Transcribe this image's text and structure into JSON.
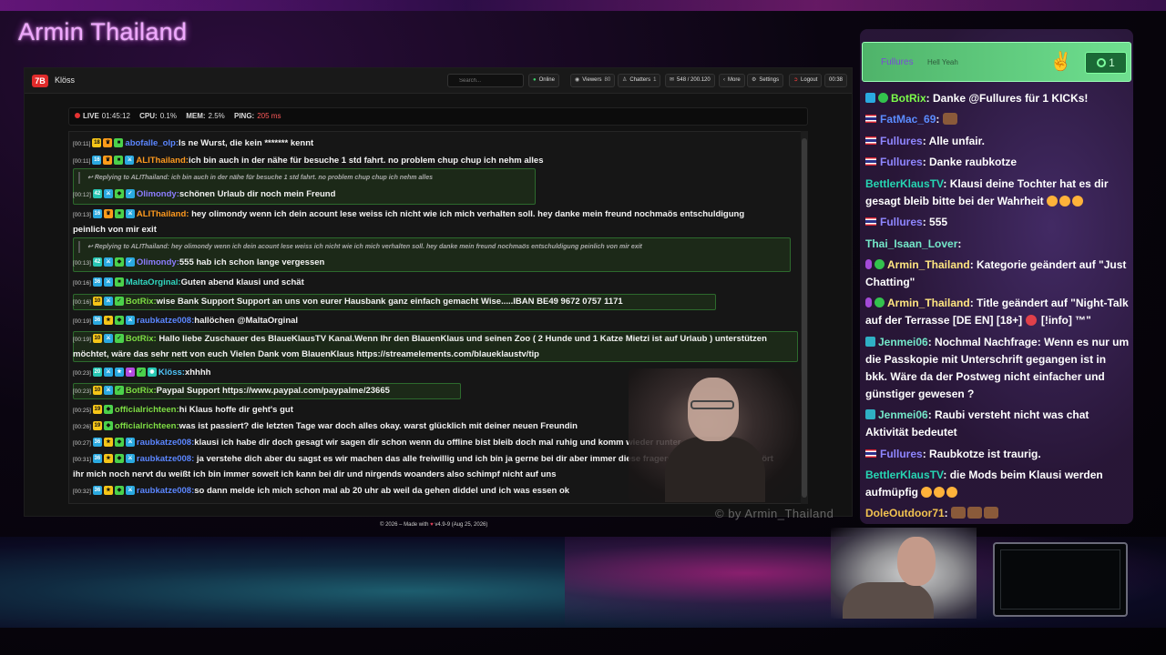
{
  "overlay": {
    "streamer_title": "Armin Thailand",
    "watermark": "© by Armin_Thailand"
  },
  "app": {
    "logo": "7B",
    "name": "Klöss",
    "search_placeholder": "Search...",
    "toolbar": {
      "online": "Online",
      "viewers_label": "Viewers",
      "viewers_count": "80",
      "chatters_label": "Chatters",
      "chatters_count": "1",
      "messages": "548 / 200.120",
      "more": "More",
      "settings": "Settings",
      "logout": "Logout",
      "timer": "00:38"
    },
    "status": {
      "live_label": "LIVE",
      "live_time": "01:45:12",
      "cpu_label": "CPU:",
      "cpu_value": "0.1%",
      "mem_label": "MEM:",
      "mem_value": "2.5%",
      "ping_label": "PING:",
      "ping_value": "205 ms"
    },
    "footer": {
      "left": "© 2026 – Made with",
      "right": "v4.9-9 (Aug 25, 2026)"
    }
  },
  "chat": [
    {
      "ts": "[00:11]",
      "badges": [
        "18"
      ],
      "user": "abofalle_olp:",
      "text": "Is ne Wurst, die kein ******* kennt"
    },
    {
      "ts": "[00:11]",
      "badges": [
        "16"
      ],
      "user": "ALIThailand:",
      "text": "ich bin auch in der nähe für besuche 1 std fahrt. no problem chup chup ich nehm alles"
    },
    {
      "reply": "Replying to ALIThailand: ich bin auch in der nähe für besuche 1 std fahrt. no problem chup chup ich nehm alles"
    },
    {
      "ts": "[00:12]",
      "badges": [
        "42"
      ],
      "user": "Olimondy:",
      "text": "schönen Urlaub dir noch mein Freund"
    },
    {
      "ts": "[00:13]",
      "badges": [
        "16"
      ],
      "user": "ALIThailand:",
      "text": "hey olimondy wenn ich dein acount lese weiss ich nicht wie ich mich verhalten soll. hey danke mein freund nochmaös entschuldigung peinlich von mir exit"
    },
    {
      "reply": "Replying to ALIThailand: hey olimondy wenn ich dein acount lese weiss ich nicht wie ich mich verhalten soll. hey danke mein freund nochmaös entschuldigung peinlich von mir exit"
    },
    {
      "ts": "[00:13]",
      "badges": [
        "42"
      ],
      "user": "Olimondy:",
      "text": "555 hab ich schon lange vergessen"
    },
    {
      "ts": "[00:16]",
      "badges": [
        "36"
      ],
      "user": "MaltaOrginal:",
      "text": "Guten abend klausi und schät"
    },
    {
      "ts": "[00:16]",
      "badges": [
        "10"
      ],
      "user": "BotRix:",
      "text": "wise Bank Support Support an uns von eurer Hausbank ganz einfach gemacht Wise.....IBAN BE49 9672 0757 1171"
    },
    {
      "ts": "[00:19]",
      "badges": [
        "36"
      ],
      "user": "raubkatze008:",
      "text": "hallöchen @MaltaOrginal"
    },
    {
      "ts": "[00:19]",
      "badges": [
        "10"
      ],
      "user": "BotRix:",
      "text": "Hallo liebe Zuschauer des BlaueKlausTV Kanal.Wenn Ihr den BlauenKlaus und seinen Zoo ( 2 Hunde und 1 Katze Mietzi ist auf Urlaub ) unterstützen möchtet, wäre das sehr nett von euch Vielen Dank vom BlauenKlaus https://streamelements.com/blaueklaustv/tip"
    },
    {
      "ts": "[00:23]",
      "badges": [
        "20"
      ],
      "user": "Klöss:",
      "text": "xhhhh"
    },
    {
      "ts": "[00:23]",
      "badges": [
        "10"
      ],
      "user": "BotRix:",
      "text": "Paypal Support https://www.paypal.com/paypalme/23665"
    },
    {
      "ts": "[00:25]",
      "badges": [
        "19"
      ],
      "user": "officialrichteen:",
      "text": "hi Klaus hoffe dir geht's gut"
    },
    {
      "ts": "[00:26]",
      "badges": [
        "19"
      ],
      "user": "officialrichteen:",
      "text": "was ist passiert? die letzten Tage war doch alles okay. warst glücklich mit deiner neuen Freundin"
    },
    {
      "ts": "[00:27]",
      "badges": [
        "36"
      ],
      "user": "raubkatze008:",
      "text": "klausi ich habe dir doch gesagt wir sagen dir schon wenn du offline bist bleib doch mal ruhig und komm wieder runter"
    },
    {
      "ts": "[00:31]",
      "badges": [
        "36"
      ],
      "user": "raubkatze008:",
      "text": "ja verstehe dich aber du sagst es wir machen das alle freiwillig und ich bin ja gerne bei dir aber immer diese fragerei bin ich online oder hört ihr mich noch nervt du weißt ich bin immer soweit ich kann bei dir und nirgends woanders also schimpf nicht auf uns"
    },
    {
      "ts": "[00:32]",
      "badges": [
        "36"
      ],
      "user": "raubkatze008:",
      "text": "so dann melde ich mich schon mal ab 20 uhr ab weil da gehen diddel und ich was essen ok"
    }
  ],
  "side_chat": {
    "top_user": "Fullures",
    "top_message": "Hell Yeah",
    "top_count": "1",
    "messages": [
      {
        "user": "BotRix",
        "text": ": Danke @Fullures für 1 KICKs!"
      },
      {
        "user": "FatMac_69",
        "text": ":"
      },
      {
        "user": "Fullures",
        "text": ": Alle unfair."
      },
      {
        "user": "Fullures",
        "text": ": Danke raubkotze"
      },
      {
        "user": "BettlerKlausTV",
        "text": ": Klausi deine Tochter hat es dir gesagt bleib bitte bei der Wahrheit"
      },
      {
        "user": "Fullures",
        "text": ": 555"
      },
      {
        "user": "Thai_Isaan_Lover",
        "text": ":"
      },
      {
        "user": "Armin_Thailand",
        "text": ": Kategorie geändert auf \"Just Chatting\""
      },
      {
        "user": "Armin_Thailand",
        "text": ": Title geändert auf \"Night-Talk auf der Terrasse [DE EN] [18+]"
      },
      {
        "user": "Jenmei06",
        "text": ": Nochmal Nachfrage: Wenn es nur um die Passkopie mit Unterschrift gegangen ist in bkk. Wäre da der Postweg nicht einfacher und günstiger gewesen ?"
      },
      {
        "user": "Jenmei06",
        "text": ": Raubi versteht nicht was chat Aktivität bedeutet"
      },
      {
        "user": "Fullures",
        "text": ": Raubkotze ist traurig."
      },
      {
        "user": "BettlerKlausTV",
        "text": ": die Mods beim Klausi werden aufmüpfig"
      },
      {
        "user": "DoleOutdoor71",
        "text": ":"
      }
    ],
    "title_suffix": "[!info] ™\""
  },
  "colors": {
    "accent_green": "#4bd14b",
    "live_red": "#e53232",
    "title_pink": "#f0a8ff"
  }
}
